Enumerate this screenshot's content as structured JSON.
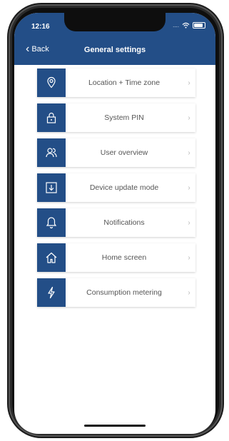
{
  "status_bar": {
    "time": "12:16",
    "signal": "...."
  },
  "header": {
    "back_label": "Back",
    "title": "General settings"
  },
  "settings": {
    "items": [
      {
        "label": "Location + Time zone",
        "icon": "location-pin-icon"
      },
      {
        "label": "System PIN",
        "icon": "lock-icon"
      },
      {
        "label": "User overview",
        "icon": "users-icon"
      },
      {
        "label": "Device update mode",
        "icon": "download-icon"
      },
      {
        "label": "Notifications",
        "icon": "bell-icon"
      },
      {
        "label": "Home screen",
        "icon": "home-icon"
      },
      {
        "label": "Consumption metering",
        "icon": "lightning-icon"
      }
    ]
  },
  "colors": {
    "header_bg": "#234e87",
    "icon_bg": "#234e87",
    "label": "#555555"
  }
}
